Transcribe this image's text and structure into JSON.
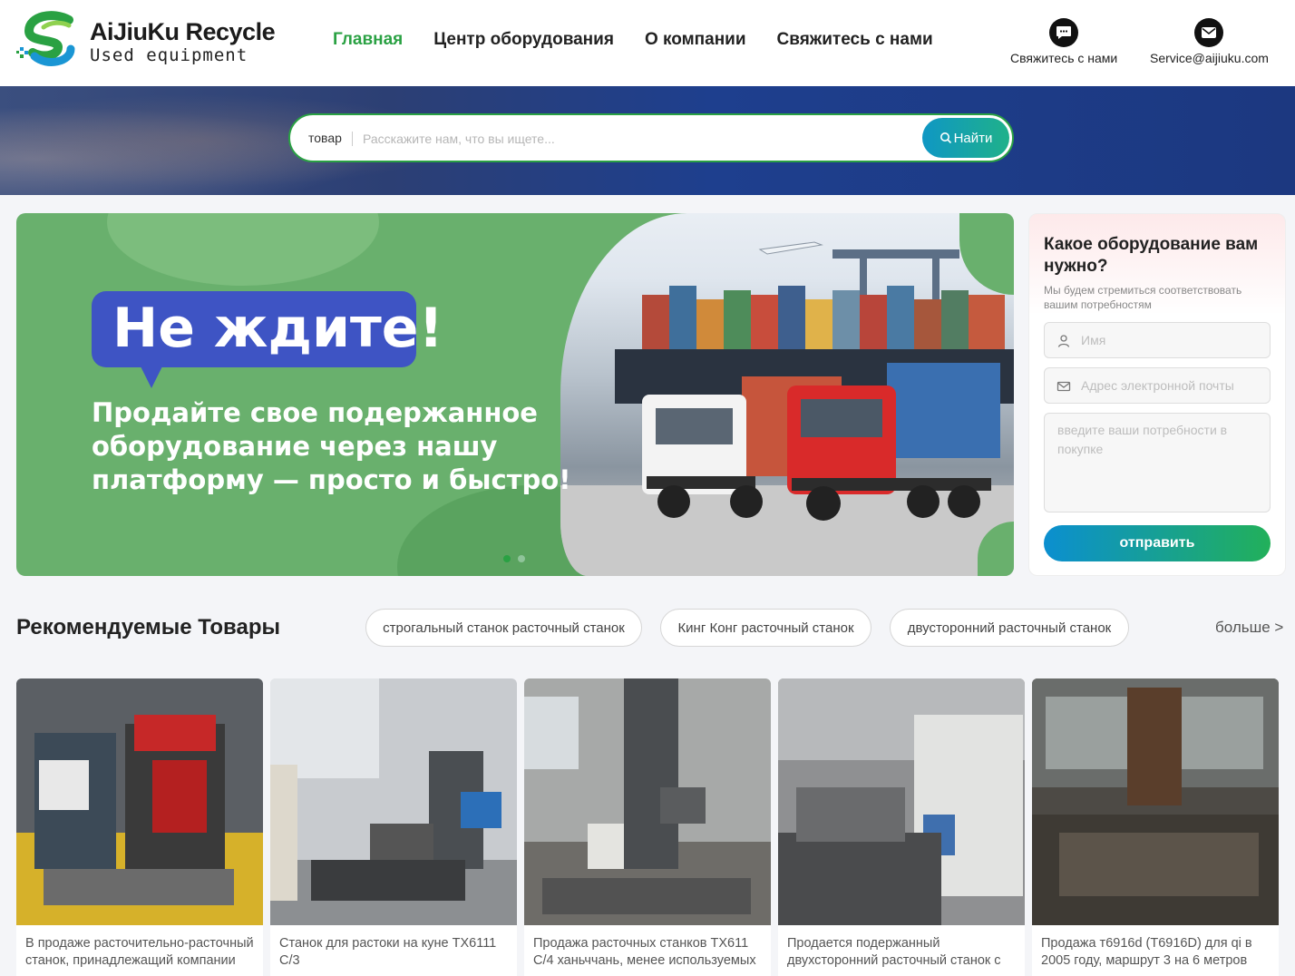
{
  "header": {
    "logo_title": "AiJiuKu Recycle",
    "logo_subtitle": "Used equipment",
    "nav": [
      "Главная",
      "Центр оборудования",
      "О компании",
      "Свяжитесь с нами"
    ],
    "active_nav": "Главная",
    "contact_label": "Свяжитесь с нами",
    "email": "Service@aijiuku.com"
  },
  "search": {
    "category": "товар",
    "placeholder": "Расскажите нам, что вы ищете...",
    "button_label": "Найти"
  },
  "banner": {
    "headline": "Не ждите!",
    "subtitle": "Продайте свое подержанное оборудование через нашу платформу — просто и быстро!",
    "slides": 2,
    "active_slide": 1
  },
  "inquiry": {
    "title": "Какое оборудование вам нужно?",
    "description": "Мы будем стремиться соответствовать вашим потребностям",
    "name_placeholder": "Имя",
    "email_placeholder": "Адрес электронной почты",
    "needs_placeholder": "введите ваши потребности в покупке",
    "submit_label": "отправить"
  },
  "recommended": {
    "title": "Рекомендуемые Товары",
    "tags": [
      "строгальный станок расточный станок",
      "Кинг Конг расточный станок",
      "двусторонний расточный станок"
    ],
    "more_label": "больше >",
    "products": [
      {
        "title": "В продаже расточительно-расточный станок, принадлежащий компании"
      },
      {
        "title": "Станок для растоки на куне TX6111 C/3"
      },
      {
        "title": "Продажа расточных станков TX611 C/4 ханьччань, менее используемых"
      },
      {
        "title": "Продается подержанный двухсторонний расточный станок с цифровым"
      },
      {
        "title": "Продажа т6916d (T6916D) для qi в 2005 году, маршрут 3 на 6 метров"
      }
    ]
  },
  "colors": {
    "brand_green": "#2aa143",
    "banner_green": "#69b06d",
    "bubble_blue": "#3e54c4",
    "search_button": "#0f97c4"
  }
}
